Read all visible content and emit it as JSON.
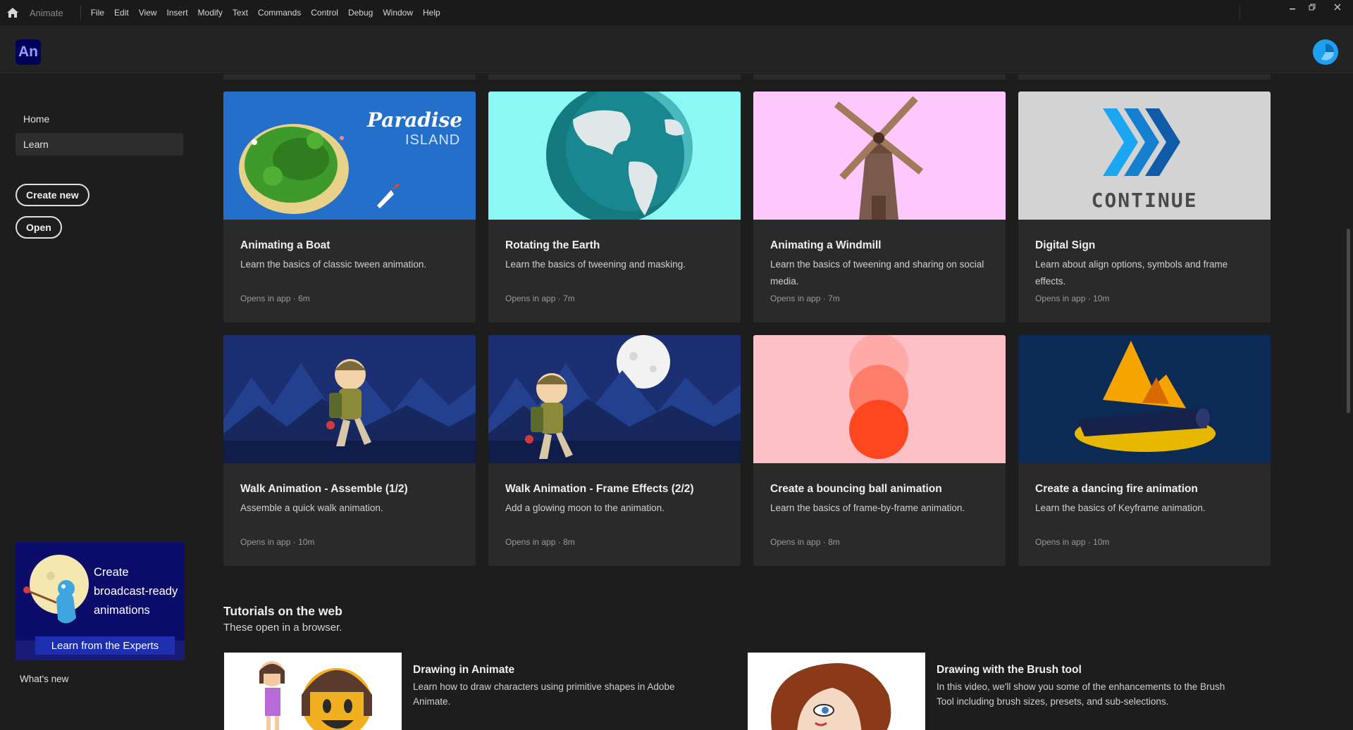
{
  "menubar": {
    "app_name": "Animate",
    "menus": [
      "File",
      "Edit",
      "View",
      "Insert",
      "Modify",
      "Text",
      "Commands",
      "Control",
      "Debug",
      "Window",
      "Help"
    ]
  },
  "topbar": {
    "logo": "An"
  },
  "sidebar": {
    "home": "Home",
    "learn": "Learn",
    "create_new": "Create new",
    "open": "Open",
    "promo": {
      "line1": "Create",
      "line2": "broadcast-ready",
      "line3": "animations",
      "cta": "Learn from the Experts"
    },
    "whats_new": "What's new"
  },
  "cards": [
    {
      "title": "Animating a Boat",
      "desc": "Learn the basics of classic tween animation.",
      "meta": "Opens in app",
      "duration": "6m",
      "icon": "paradise-island-image"
    },
    {
      "title": "Rotating the Earth",
      "desc": "Learn the basics of tweening and masking.",
      "meta": "Opens in app",
      "duration": "7m",
      "icon": "earth-globe-image"
    },
    {
      "title": "Animating a Windmill",
      "desc": "Learn the basics of tweening and sharing on social media.",
      "meta": "Opens in app",
      "duration": "7m",
      "icon": "windmill-image"
    },
    {
      "title": "Digital Sign",
      "desc": "Learn about align options, symbols and frame effects.",
      "meta": "Opens in app",
      "duration": "10m",
      "icon": "continue-sign-image"
    },
    {
      "title": "Walk Animation - Assemble (1/2)",
      "desc": "Assemble a quick walk animation.",
      "meta": "Opens in app",
      "duration": "10m",
      "icon": "walking-hiker-image"
    },
    {
      "title": "Walk Animation - Frame Effects (2/2)",
      "desc": "Add a glowing moon to the animation.",
      "meta": "Opens in app",
      "duration": "8m",
      "icon": "hiker-moon-image"
    },
    {
      "title": "Create a bouncing ball animation",
      "desc": "Learn the basics of frame-by-frame animation.",
      "meta": "Opens in app",
      "duration": "8m",
      "icon": "bouncing-ball-image"
    },
    {
      "title": "Create a dancing fire animation",
      "desc": "Learn the basics of Keyframe animation.",
      "meta": "Opens in app",
      "duration": "10m",
      "icon": "campfire-image"
    }
  ],
  "promo_sign_text": "CONTINUE",
  "promo_island_text": {
    "line1": "Paradise",
    "line2": "ISLAND"
  },
  "web_section": {
    "title": "Tutorials on the web",
    "subtitle": "These open in a browser.",
    "items": [
      {
        "title": "Drawing in Animate",
        "desc": "Learn how to draw characters using primitive shapes in Adobe Animate."
      },
      {
        "title": "Drawing with the Brush tool",
        "desc": "In this video, we'll show you some of the enhancements to the Brush Tool including brush sizes, presets, and sub-selections."
      }
    ]
  },
  "colors": {
    "accent": "#1ea0f2",
    "logo_bg": "#00005b",
    "logo_fg": "#9999ff",
    "card_bg": "#2a2a2a",
    "page_bg": "#1d1d1d"
  }
}
